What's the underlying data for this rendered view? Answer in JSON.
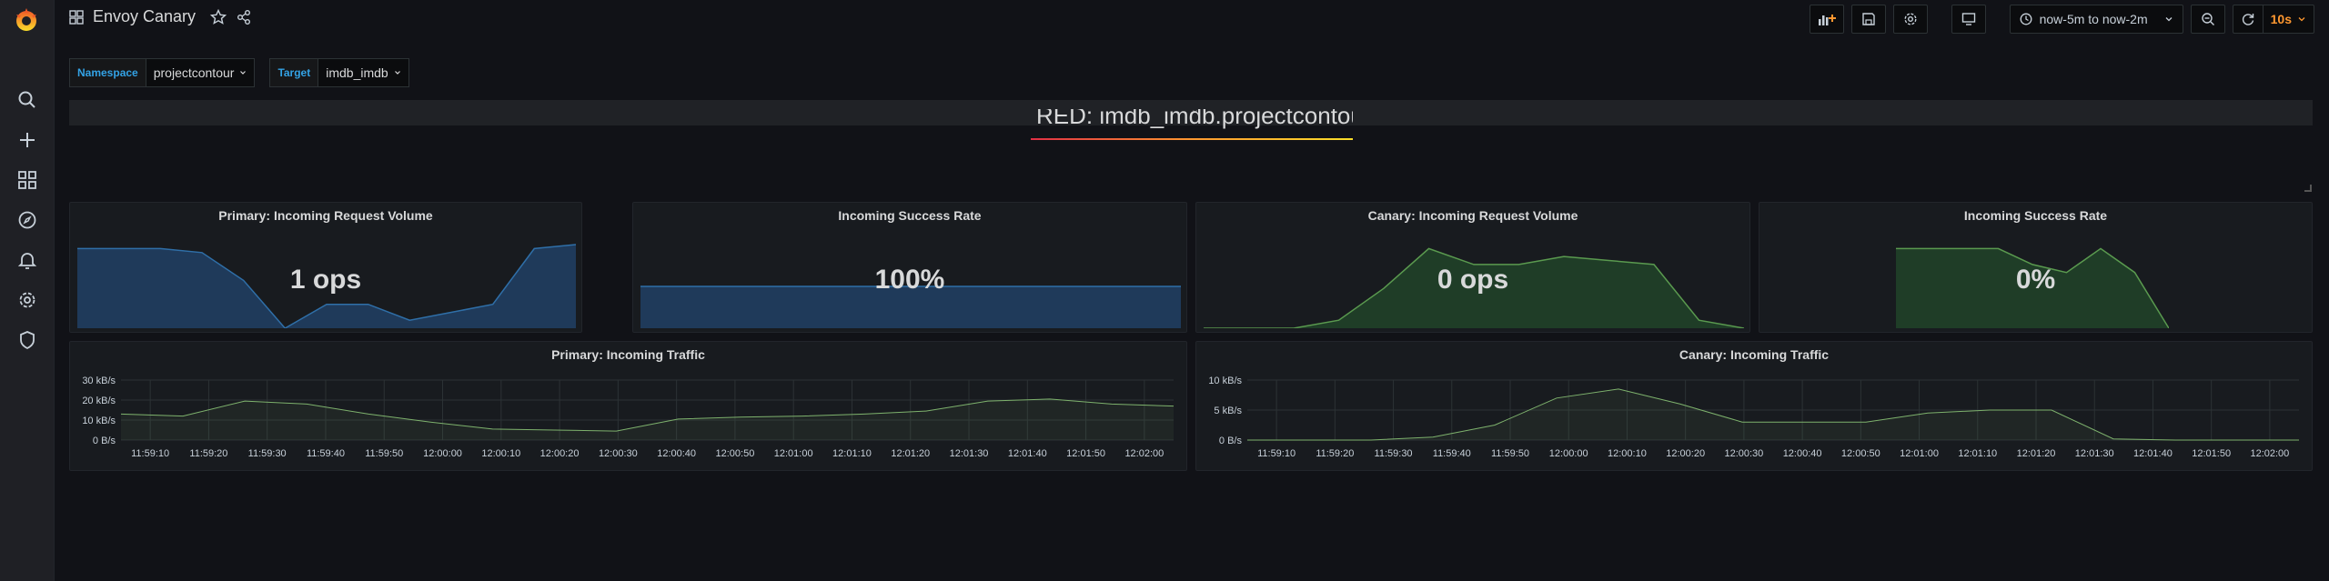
{
  "dashboard": {
    "title": "Envoy Canary"
  },
  "toolbar": {
    "time_range": "now-5m to now-2m",
    "refresh_interval": "10s"
  },
  "variables": [
    {
      "label": "Namespace",
      "value": "projectcontour"
    },
    {
      "label": "Target",
      "value": "imdb_imdb"
    }
  ],
  "row": {
    "title": "RED: imdb_imdb.projectcontour"
  },
  "colors": {
    "primary_fill": "#1f3a5a",
    "primary_line": "#2f6fa8",
    "canary_fill": "#1f3d27",
    "canary_line": "#5a9a4f",
    "traffic_line": "#7eb26d"
  },
  "stats": [
    {
      "title": "Primary: Incoming Request Volume",
      "value": "1 ops"
    },
    {
      "title": "Incoming Success Rate",
      "value": "100%"
    },
    {
      "title": "Canary: Incoming Request Volume",
      "value": "0 ops"
    },
    {
      "title": "Incoming Success Rate",
      "value": "0%"
    }
  ],
  "chart_data": [
    {
      "type": "line",
      "title": "Primary: Incoming Traffic",
      "x": [
        "11:59:10",
        "11:59:20",
        "11:59:30",
        "11:59:40",
        "11:59:50",
        "12:00:00",
        "12:00:10",
        "12:00:20",
        "12:00:30",
        "12:00:40",
        "12:00:50",
        "12:01:00",
        "12:01:10",
        "12:01:20",
        "12:01:30",
        "12:01:40",
        "12:01:50",
        "12:02:00"
      ],
      "y_ticks": [
        "0 B/s",
        "10 kB/s",
        "20 kB/s",
        "30 kB/s"
      ],
      "ylim": [
        0,
        30
      ],
      "unit": "kB/s",
      "series": [
        {
          "values": [
            13,
            12,
            19.5,
            18,
            13,
            9,
            5.5,
            5,
            4.5,
            10.5,
            11.5,
            12,
            13,
            14.5,
            19.5,
            20.5,
            18,
            17
          ]
        }
      ]
    },
    {
      "type": "line",
      "title": "Canary: Incoming Traffic",
      "x": [
        "11:59:10",
        "11:59:20",
        "11:59:30",
        "11:59:40",
        "11:59:50",
        "12:00:00",
        "12:00:10",
        "12:00:20",
        "12:00:30",
        "12:00:40",
        "12:00:50",
        "12:01:00",
        "12:01:10",
        "12:01:20",
        "12:01:30",
        "12:01:40",
        "12:01:50",
        "12:02:00"
      ],
      "y_ticks": [
        "0 B/s",
        "5 kB/s",
        "10 kB/s"
      ],
      "ylim": [
        0,
        10
      ],
      "unit": "kB/s",
      "series": [
        {
          "values": [
            0,
            0,
            0,
            0.5,
            2.5,
            7,
            8.5,
            6,
            3,
            3,
            3,
            4.5,
            5,
            5,
            0.2,
            0,
            0,
            0
          ]
        }
      ]
    }
  ],
  "sparklines": {
    "primary_volume": [
      1,
      1,
      1,
      0.95,
      0.6,
      0,
      0.3,
      0.3,
      0.1,
      0.2,
      0.3,
      1,
      1.05
    ],
    "primary_success": [
      1,
      1,
      1,
      1,
      1,
      1,
      1,
      1,
      1,
      1
    ],
    "canary_volume": [
      0,
      0,
      0,
      0.1,
      0.5,
      1,
      0.8,
      0.8,
      0.9,
      0.85,
      0.8,
      0.1,
      0
    ],
    "canary_success": [
      1,
      1,
      1,
      1,
      0.8,
      0.7,
      1,
      0.7,
      0
    ]
  }
}
